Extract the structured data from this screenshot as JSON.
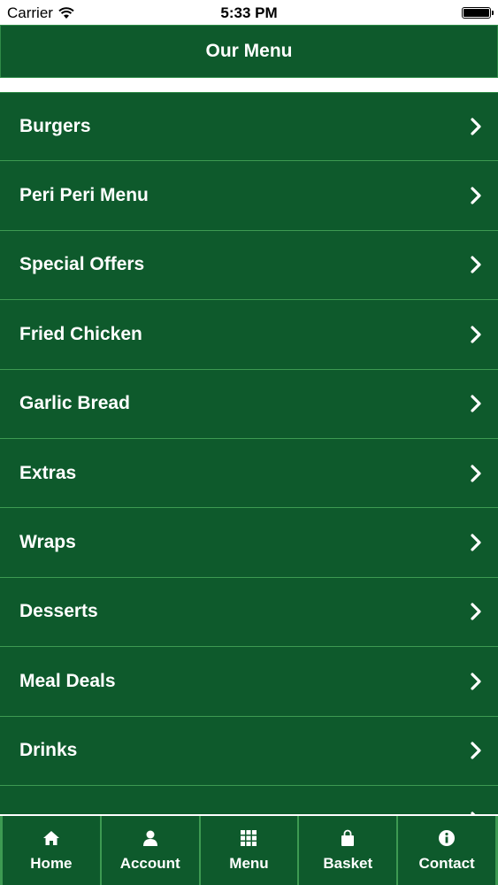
{
  "status_bar": {
    "carrier": "Carrier",
    "time": "5:33 PM",
    "wifi_icon": "wifi-icon",
    "battery_icon": "battery-full-icon"
  },
  "header": {
    "title": "Our Menu"
  },
  "menu": {
    "items": [
      {
        "label": "Burgers"
      },
      {
        "label": "Peri Peri Menu"
      },
      {
        "label": "Special Offers"
      },
      {
        "label": "Fried Chicken"
      },
      {
        "label": "Garlic Bread"
      },
      {
        "label": "Extras"
      },
      {
        "label": "Wraps"
      },
      {
        "label": "Desserts"
      },
      {
        "label": "Meal Deals"
      },
      {
        "label": "Drinks"
      },
      {
        "label": ""
      }
    ],
    "chevron_icon": "chevron-right-icon"
  },
  "tabs": [
    {
      "label": "Home",
      "icon": "home-icon"
    },
    {
      "label": "Account",
      "icon": "user-icon"
    },
    {
      "label": "Menu",
      "icon": "grid-icon"
    },
    {
      "label": "Basket",
      "icon": "shopping-bag-icon"
    },
    {
      "label": "Contact",
      "icon": "info-icon"
    }
  ],
  "colors": {
    "primary_green": "#0e5a2c",
    "divider_green": "#3d9a52",
    "text_white": "#ffffff"
  }
}
